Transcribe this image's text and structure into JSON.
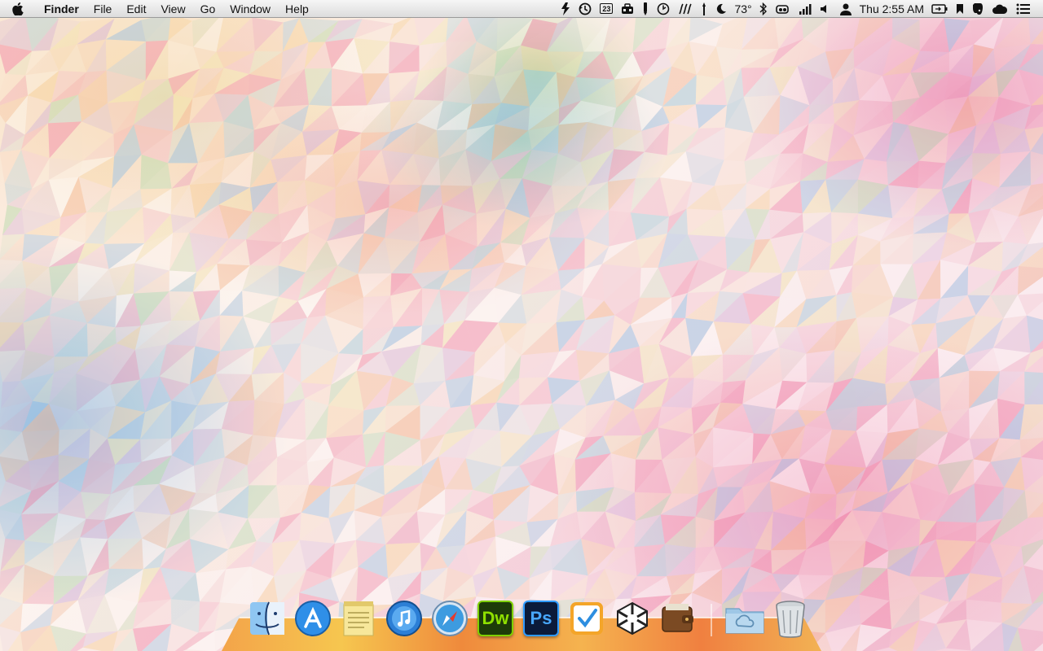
{
  "menubar": {
    "app_name": "Finder",
    "menus": [
      "File",
      "Edit",
      "View",
      "Go",
      "Window",
      "Help"
    ],
    "status_items": [
      {
        "icon": "evernote-elephant-icon"
      },
      {
        "icon": "time-machine-icon"
      },
      {
        "icon": "calendar-icon",
        "text": "23"
      },
      {
        "icon": "toolbox-icon"
      },
      {
        "icon": "pencil-icon"
      },
      {
        "icon": "clock-icon"
      },
      {
        "icon": "scroll-icon"
      },
      {
        "icon": "brush-icon"
      },
      {
        "icon": "moon-icon"
      },
      {
        "icon": "weather-temperature",
        "text": "73°"
      },
      {
        "icon": "bluetooth-icon"
      },
      {
        "icon": "glasses-icon"
      },
      {
        "icon": "signal-bars-icon"
      },
      {
        "icon": "volume-icon"
      },
      {
        "icon": "user-icon"
      },
      {
        "icon": "clock-text",
        "text": "Thu 2:55 AM"
      },
      {
        "icon": "battery-icon"
      },
      {
        "icon": "bookmark-icon"
      },
      {
        "icon": "evernote-icon"
      },
      {
        "icon": "cloud-icon"
      },
      {
        "icon": "list-menu-icon"
      }
    ]
  },
  "dock": {
    "apps": [
      {
        "name": "Finder",
        "icon": "finder-icon"
      },
      {
        "name": "App Store",
        "icon": "app-store-icon"
      },
      {
        "name": "Stickies",
        "icon": "stickies-icon"
      },
      {
        "name": "iTunes",
        "icon": "itunes-icon"
      },
      {
        "name": "Safari",
        "icon": "safari-icon"
      },
      {
        "name": "Dreamweaver",
        "icon": "dreamweaver-icon",
        "label": "Dw"
      },
      {
        "name": "Photoshop",
        "icon": "photoshop-icon",
        "label": "Ps"
      },
      {
        "name": "Tasks",
        "icon": "checkmark-app-icon"
      },
      {
        "name": "Unity",
        "icon": "unity-icon"
      },
      {
        "name": "Wallet",
        "icon": "wallet-icon"
      }
    ],
    "folders": [
      {
        "name": "Creative Cloud Files",
        "icon": "creative-cloud-folder-icon"
      },
      {
        "name": "Trash",
        "icon": "trash-icon"
      }
    ]
  },
  "colors": {
    "menubar": "#e6e6e6",
    "dock_shelf": "#f3a44a",
    "wallpaper_base": "#fbe9d8",
    "accent_pink": "#ec6f9a",
    "accent_blue": "#7fb6e0"
  }
}
